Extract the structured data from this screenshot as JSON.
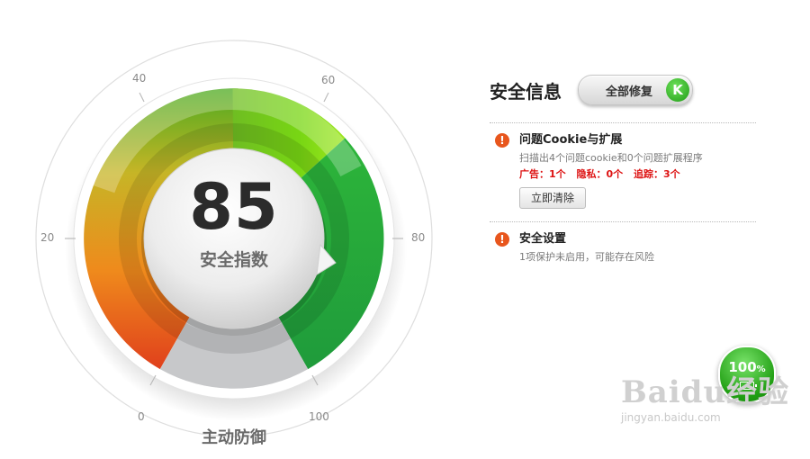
{
  "gauge": {
    "score": "85",
    "score_label": "安全指数",
    "bottom_label": "主动防御",
    "ticks": [
      "0",
      "20",
      "40",
      "60",
      "80",
      "100"
    ]
  },
  "security_panel": {
    "title": "安全信息",
    "fix_all_label": "全部修复",
    "fix_all_icon": "K",
    "issues": [
      {
        "icon": "warning-icon",
        "title": "问题Cookie与扩展",
        "description": "扫描出4个问题cookie和0个问题扩展程序",
        "stats": [
          "广告：1个",
          "隐私：0个",
          "追踪：3个"
        ],
        "action_label": "立即清除"
      },
      {
        "icon": "warning-icon",
        "title": "安全设置",
        "description": "1项保护未启用，可能存在风险"
      }
    ]
  },
  "battery_badge": {
    "value": "100",
    "unit": "%"
  },
  "watermark": {
    "brand": "Baidu经验",
    "url": "jingyan.baidu.com"
  },
  "colors": {
    "warning": "#e8561d",
    "stats_red": "#dd1111",
    "brand_green": "#1f9d12"
  }
}
